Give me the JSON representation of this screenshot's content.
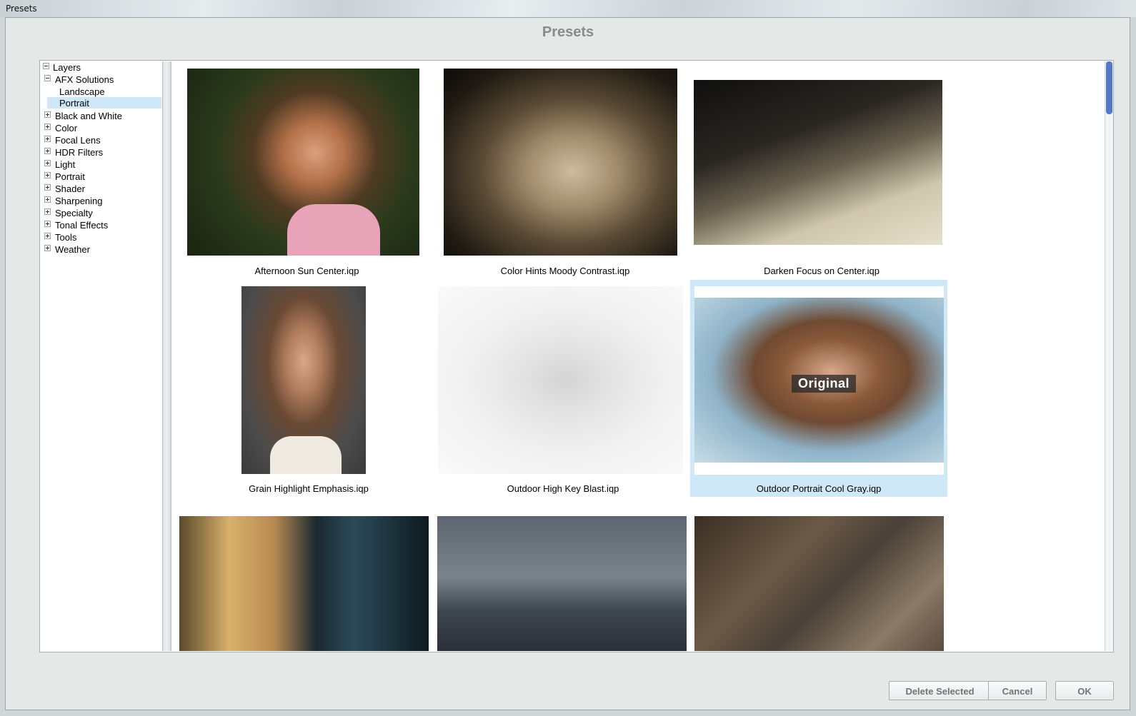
{
  "window": {
    "title": "Presets"
  },
  "dialog": {
    "heading": "Presets"
  },
  "tree": {
    "root": "Layers",
    "expanded": "AFX Solutions",
    "children": [
      "Landscape",
      "Portrait"
    ],
    "selected": "Portrait",
    "collapsed": [
      "Black and White",
      "Color",
      "Focal Lens",
      "HDR Filters",
      "Light",
      "Portrait",
      "Shader",
      "Sharpening",
      "Specialty",
      "Tonal Effects",
      "Tools",
      "Weather"
    ]
  },
  "presets": [
    {
      "caption": "Afternoon Sun Center.iqp"
    },
    {
      "caption": "Color Hints Moody Contrast.iqp"
    },
    {
      "caption": "Darken Focus on Center.iqp"
    },
    {
      "caption": "Grain Highlight Emphasis.iqp"
    },
    {
      "caption": "Outdoor High Key Blast.iqp"
    },
    {
      "caption": "Outdoor Portrait Cool Gray.iqp",
      "selected": true,
      "badge": "Original"
    },
    {
      "caption": ""
    },
    {
      "caption": ""
    },
    {
      "caption": ""
    }
  ],
  "buttons": {
    "delete": "Delete Selected",
    "cancel": "Cancel",
    "ok": "OK"
  },
  "colors": {
    "selection": "#cfe8f7",
    "scroll_thumb": "#5577c8"
  }
}
